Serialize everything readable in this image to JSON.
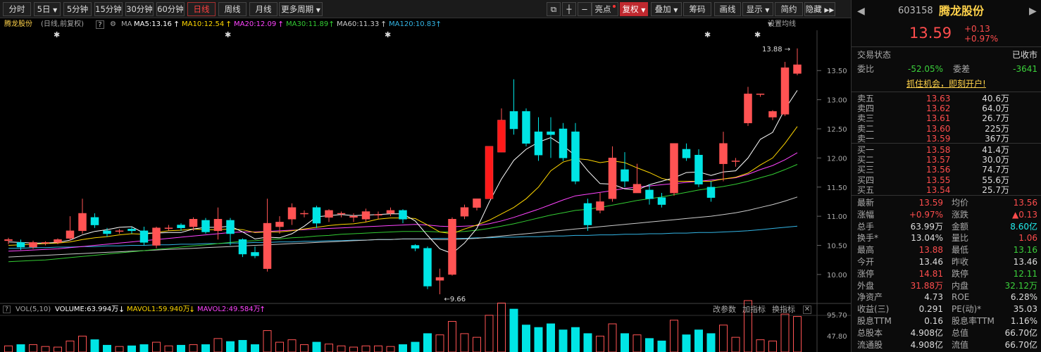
{
  "toolbar": {
    "periods": [
      "分时",
      "5日",
      "5分钟",
      "15分钟",
      "30分钟",
      "60分钟",
      "日线",
      "周线",
      "月线",
      "更多周期"
    ],
    "active": "日线",
    "right_buttons": [
      "亮点",
      "复权",
      "叠加",
      "筹码",
      "画线",
      "显示",
      "简约",
      "隐藏"
    ]
  },
  "ma_bar": {
    "stock": "腾龙股份",
    "mode": "(日线,前复权)",
    "help": "?",
    "ma_label": "MA",
    "ma5": "MA5:13.16",
    "ma10": "MA10:12.54",
    "ma20": "MA20:12.09",
    "ma30": "MA30:11.89",
    "ma60": "MA60:11.33",
    "ma120": "MA120:10.83",
    "settings": "设置均线"
  },
  "colors": {
    "ma5": "#ffffff",
    "ma10": "#ffd700",
    "ma20": "#ff44ff",
    "ma30": "#33cc33",
    "ma60": "#cccccc",
    "ma120": "#33b5e5",
    "up": "#ff5353",
    "down": "#00e5e5"
  },
  "vol_bar": {
    "label": "VOL(5,10)",
    "volume": "VOLUME:63.994万",
    "mavol1": "MAVOL1:59.940万",
    "mavol2": "MAVOL2:49.584万",
    "tools": [
      "改参数",
      "加指标",
      "换指标"
    ]
  },
  "chart_data": {
    "type": "candlestick",
    "ylim": [
      9.6,
      13.95
    ],
    "y_ticks": [
      "13.50",
      "13.00",
      "12.50",
      "12.00",
      "11.50",
      "11.00",
      "10.50",
      "10.00"
    ],
    "high_marker": "13.88",
    "low_marker": "9.66",
    "vol_ticks": [
      "95.70",
      "47.80"
    ],
    "candles": [
      [
        10.58,
        10.6,
        10.52,
        10.63,
        10
      ],
      [
        10.55,
        10.47,
        10.42,
        10.6,
        12
      ],
      [
        10.47,
        10.55,
        10.44,
        10.58,
        12
      ],
      [
        10.55,
        10.55,
        10.5,
        10.57,
        9
      ],
      [
        10.55,
        10.6,
        10.52,
        10.62,
        8
      ],
      [
        10.62,
        10.75,
        10.58,
        11.0,
        18
      ],
      [
        10.75,
        11.05,
        10.7,
        11.3,
        26
      ],
      [
        10.98,
        10.85,
        10.8,
        11.05,
        20
      ],
      [
        10.75,
        10.7,
        10.65,
        10.8,
        11
      ],
      [
        10.75,
        10.75,
        10.7,
        10.78,
        9
      ],
      [
        10.78,
        10.75,
        10.7,
        10.82,
        10
      ],
      [
        10.75,
        10.55,
        10.5,
        10.82,
        12
      ],
      [
        10.5,
        10.8,
        10.45,
        10.82,
        16
      ],
      [
        10.8,
        10.8,
        10.75,
        10.85,
        10
      ],
      [
        10.85,
        10.8,
        10.75,
        10.88,
        11
      ],
      [
        10.82,
        10.95,
        10.75,
        10.98,
        12
      ],
      [
        10.93,
        10.73,
        10.7,
        10.97,
        12
      ],
      [
        10.75,
        10.95,
        10.6,
        11.15,
        22
      ],
      [
        10.93,
        10.7,
        10.5,
        10.97,
        17
      ],
      [
        10.6,
        10.35,
        10.3,
        10.62,
        19
      ],
      [
        10.38,
        10.32,
        10.28,
        10.48,
        12
      ],
      [
        10.1,
        10.88,
        10.05,
        11.3,
        35
      ],
      [
        10.82,
        10.9,
        10.7,
        11.0,
        16
      ],
      [
        10.95,
        11.15,
        10.85,
        11.22,
        20
      ],
      [
        11.05,
        11.05,
        10.98,
        11.1,
        12
      ],
      [
        11.15,
        10.88,
        10.8,
        11.18,
        16
      ],
      [
        10.98,
        11.1,
        10.9,
        11.12,
        13
      ],
      [
        11.05,
        11.05,
        10.98,
        11.08,
        10
      ],
      [
        10.98,
        11.0,
        10.9,
        11.05,
        8
      ],
      [
        10.95,
        11.08,
        10.9,
        11.13,
        10
      ],
      [
        11.03,
        11.03,
        10.95,
        11.08,
        10
      ],
      [
        11.05,
        11.1,
        11.0,
        11.15,
        9
      ],
      [
        11.1,
        10.95,
        10.88,
        11.12,
        12
      ],
      [
        10.5,
        10.45,
        10.4,
        10.52,
        16
      ],
      [
        10.45,
        9.8,
        9.75,
        10.48,
        30
      ],
      [
        9.9,
        9.95,
        9.66,
        10.1,
        28
      ],
      [
        10.0,
        10.95,
        9.98,
        10.98,
        50
      ],
      [
        11.0,
        11.15,
        10.95,
        11.2,
        30
      ],
      [
        11.15,
        11.3,
        11.1,
        11.3,
        24
      ],
      [
        11.3,
        12.2,
        11.3,
        12.2,
        60
      ],
      [
        12.1,
        12.65,
        12.1,
        12.85,
        80
      ],
      [
        12.8,
        12.5,
        12.4,
        13.35,
        70
      ],
      [
        12.8,
        12.25,
        12.2,
        12.85,
        44
      ],
      [
        12.45,
        12.05,
        11.95,
        12.7,
        40
      ],
      [
        12.45,
        12.4,
        12.0,
        12.7,
        46
      ],
      [
        12.5,
        12.0,
        11.95,
        12.6,
        36
      ],
      [
        12.45,
        11.6,
        11.55,
        12.6,
        40
      ],
      [
        11.22,
        10.85,
        10.75,
        11.3,
        30
      ],
      [
        11.1,
        11.25,
        11.05,
        11.4,
        26
      ],
      [
        11.3,
        12.0,
        11.25,
        12.2,
        46
      ],
      [
        11.8,
        11.6,
        11.5,
        12.1,
        30
      ],
      [
        11.4,
        11.55,
        11.4,
        11.9,
        28
      ],
      [
        11.45,
        11.3,
        11.2,
        11.55,
        22
      ],
      [
        11.32,
        11.2,
        11.15,
        11.4,
        18
      ],
      [
        11.4,
        12.25,
        11.35,
        12.25,
        52
      ],
      [
        12.15,
        12.0,
        11.95,
        12.25,
        28
      ],
      [
        12.05,
        11.55,
        11.5,
        12.15,
        36
      ],
      [
        11.5,
        11.32,
        11.25,
        11.6,
        30
      ],
      [
        11.9,
        12.25,
        11.6,
        12.45,
        44
      ],
      [
        11.95,
        11.95,
        11.85,
        12.0,
        24
      ],
      [
        12.6,
        13.1,
        12.55,
        13.22,
        84
      ],
      [
        13.1,
        13.1,
        13.05,
        13.1,
        20
      ],
      [
        12.7,
        12.8,
        12.65,
        12.82,
        18
      ],
      [
        12.75,
        13.55,
        12.72,
        13.65,
        62
      ],
      [
        13.45,
        13.6,
        13.42,
        13.88,
        58
      ]
    ],
    "ma5": [
      10.56,
      10.55,
      10.54,
      10.54,
      10.55,
      10.59,
      10.68,
      10.74,
      10.77,
      10.81,
      10.82,
      10.71,
      10.71,
      10.72,
      10.72,
      10.78,
      10.81,
      10.81,
      10.83,
      10.73,
      10.61,
      10.64,
      10.63,
      10.7,
      10.83,
      10.99,
      11.01,
      11.03,
      11.01,
      11.02,
      11.03,
      11.04,
      11.04,
      10.92,
      10.67,
      10.44,
      10.36,
      10.54,
      10.79,
      11.24,
      11.64,
      11.96,
      12.15,
      12.27,
      12.35,
      12.21,
      12.04,
      11.78,
      11.56,
      11.55,
      11.47,
      11.45,
      11.54,
      11.6,
      11.66,
      11.75,
      11.76,
      11.7,
      11.76,
      11.78,
      12.0,
      12.32,
      12.44,
      12.84,
      13.16
    ],
    "ma10": [
      10.5,
      10.51,
      10.52,
      10.53,
      10.54,
      10.56,
      10.6,
      10.63,
      10.65,
      10.68,
      10.7,
      10.69,
      10.72,
      10.75,
      10.76,
      10.78,
      10.77,
      10.77,
      10.78,
      10.77,
      10.72,
      10.73,
      10.73,
      10.75,
      10.78,
      10.81,
      10.84,
      10.86,
      10.87,
      10.9,
      10.95,
      10.97,
      10.97,
      10.96,
      10.85,
      10.73,
      10.7,
      10.78,
      10.85,
      10.93,
      11.04,
      11.15,
      11.3,
      11.5,
      11.78,
      11.93,
      11.99,
      11.97,
      11.92,
      11.95,
      11.92,
      11.83,
      11.75,
      11.65,
      11.6,
      11.6,
      11.6,
      11.6,
      11.64,
      11.67,
      11.74,
      11.88,
      12.0,
      12.25,
      12.54
    ],
    "ma20": [
      10.4,
      10.41,
      10.42,
      10.43,
      10.44,
      10.46,
      10.48,
      10.5,
      10.52,
      10.54,
      10.56,
      10.58,
      10.6,
      10.62,
      10.64,
      10.66,
      10.68,
      10.7,
      10.72,
      10.73,
      10.73,
      10.74,
      10.75,
      10.76,
      10.77,
      10.78,
      10.79,
      10.8,
      10.81,
      10.82,
      10.83,
      10.84,
      10.85,
      10.86,
      10.85,
      10.83,
      10.82,
      10.83,
      10.84,
      10.87,
      10.92,
      10.98,
      11.05,
      11.12,
      11.2,
      11.28,
      11.35,
      11.38,
      11.41,
      11.44,
      11.48,
      11.5,
      11.52,
      11.54,
      11.56,
      11.58,
      11.6,
      11.62,
      11.64,
      11.66,
      11.72,
      11.8,
      11.87,
      11.97,
      12.09
    ],
    "ma30": [
      10.22,
      10.23,
      10.24,
      10.25,
      10.27,
      10.29,
      10.31,
      10.33,
      10.35,
      10.37,
      10.39,
      10.41,
      10.43,
      10.45,
      10.47,
      10.49,
      10.51,
      10.53,
      10.55,
      10.57,
      10.58,
      10.6,
      10.61,
      10.63,
      10.64,
      10.66,
      10.67,
      10.69,
      10.7,
      10.71,
      10.72,
      10.73,
      10.74,
      10.74,
      10.74,
      10.73,
      10.73,
      10.74,
      10.76,
      10.79,
      10.83,
      10.87,
      10.92,
      10.97,
      11.02,
      11.06,
      11.1,
      11.12,
      11.15,
      11.19,
      11.23,
      11.27,
      11.3,
      11.33,
      11.37,
      11.41,
      11.45,
      11.48,
      11.51,
      11.55,
      11.6,
      11.66,
      11.72,
      11.8,
      11.89
    ],
    "ma60": [
      10.3,
      10.31,
      10.32,
      10.33,
      10.34,
      10.35,
      10.36,
      10.37,
      10.38,
      10.39,
      10.4,
      10.41,
      10.42,
      10.43,
      10.44,
      10.45,
      10.46,
      10.47,
      10.48,
      10.49,
      10.5,
      10.51,
      10.52,
      10.53,
      10.54,
      10.55,
      10.56,
      10.57,
      10.58,
      10.59,
      10.6,
      10.6,
      10.61,
      10.61,
      10.61,
      10.6,
      10.6,
      10.61,
      10.62,
      10.64,
      10.66,
      10.68,
      10.7,
      10.72,
      10.74,
      10.76,
      10.78,
      10.8,
      10.82,
      10.84,
      10.86,
      10.88,
      10.9,
      10.92,
      10.94,
      10.96,
      10.98,
      11.0,
      11.03,
      11.06,
      11.1,
      11.15,
      11.2,
      11.26,
      11.33
    ],
    "ma120": [
      10.45,
      10.45,
      10.46,
      10.46,
      10.47,
      10.47,
      10.48,
      10.48,
      10.49,
      10.49,
      10.5,
      10.5,
      10.51,
      10.51,
      10.52,
      10.52,
      10.53,
      10.53,
      10.54,
      10.54,
      10.55,
      10.55,
      10.56,
      10.56,
      10.57,
      10.57,
      10.58,
      10.58,
      10.59,
      10.59,
      10.6,
      10.6,
      10.61,
      10.61,
      10.61,
      10.62,
      10.62,
      10.62,
      10.63,
      10.63,
      10.64,
      10.64,
      10.65,
      10.65,
      10.66,
      10.66,
      10.67,
      10.67,
      10.68,
      10.68,
      10.69,
      10.69,
      10.7,
      10.7,
      10.71,
      10.71,
      10.72,
      10.72,
      10.73,
      10.74,
      10.75,
      10.77,
      10.79,
      10.81,
      10.83
    ]
  },
  "quote": {
    "code": "603158",
    "name": "腾龙股份",
    "price": "13.59",
    "change": "+0.13",
    "change_pct": "+0.97%",
    "status_label": "交易状态",
    "status_value": "已收市",
    "weibi_label": "委比",
    "weibi_value": "-52.05%",
    "weicha_label": "委差",
    "weicha_value": "-3641",
    "promo": "抓住机会，即刻开户!",
    "asks": [
      {
        "label": "卖五",
        "price": "13.63",
        "vol": "40.6万"
      },
      {
        "label": "卖四",
        "price": "13.62",
        "vol": "64.0万"
      },
      {
        "label": "卖三",
        "price": "13.61",
        "vol": "26.7万"
      },
      {
        "label": "卖二",
        "price": "13.60",
        "vol": "225万"
      },
      {
        "label": "卖一",
        "price": "13.59",
        "vol": "367万"
      }
    ],
    "bids": [
      {
        "label": "买一",
        "price": "13.58",
        "vol": "41.4万"
      },
      {
        "label": "买二",
        "price": "13.57",
        "vol": "30.0万"
      },
      {
        "label": "买三",
        "price": "13.56",
        "vol": "74.7万"
      },
      {
        "label": "买四",
        "price": "13.55",
        "vol": "55.6万"
      },
      {
        "label": "买五",
        "price": "13.54",
        "vol": "25.7万"
      }
    ],
    "stats": [
      {
        "l1": "最新",
        "v1": "13.59",
        "c1": "red",
        "l2": "均价",
        "v2": "13.56",
        "c2": "red"
      },
      {
        "l1": "涨幅",
        "v1": "+0.97%",
        "c1": "red",
        "l2": "涨跌",
        "v2": "▲0.13",
        "c2": "red"
      },
      {
        "l1": "总手",
        "v1": "63.99万",
        "c1": "white",
        "l2": "金额",
        "v2": "8.60亿",
        "c2": "cyan"
      },
      {
        "l1": "换手*",
        "v1": "13.04%",
        "c1": "white",
        "l2": "量比",
        "v2": "1.06",
        "c2": "red"
      },
      {
        "l1": "最高",
        "v1": "13.88",
        "c1": "red",
        "l2": "最低",
        "v2": "13.16",
        "c2": "green"
      },
      {
        "l1": "今开",
        "v1": "13.46",
        "c1": "white",
        "l2": "昨收",
        "v2": "13.46",
        "c2": "white"
      },
      {
        "l1": "涨停",
        "v1": "14.81",
        "c1": "red",
        "l2": "跌停",
        "v2": "12.11",
        "c2": "green"
      },
      {
        "l1": "外盘",
        "v1": "31.88万",
        "c1": "red",
        "l2": "内盘",
        "v2": "32.12万",
        "c2": "green"
      },
      {
        "l1": "净资产",
        "v1": "4.73",
        "c1": "white",
        "l2": "ROE",
        "v2": "6.28%",
        "c2": "white"
      },
      {
        "l1": "收益(三)",
        "v1": "0.291",
        "c1": "white",
        "l2": "PE(动)*",
        "v2": "35.03",
        "c2": "white"
      },
      {
        "l1": "股息TTM",
        "v1": "0.16",
        "c1": "white",
        "l2": "股息率TTM",
        "v2": "1.16%",
        "c2": "white"
      },
      {
        "l1": "总股本",
        "v1": "4.908亿",
        "c1": "white",
        "l2": "总值",
        "v2": "66.70亿",
        "c2": "white"
      },
      {
        "l1": "流通股",
        "v1": "4.908亿",
        "c1": "white",
        "l2": "流值",
        "v2": "66.70亿",
        "c2": "white"
      }
    ]
  }
}
